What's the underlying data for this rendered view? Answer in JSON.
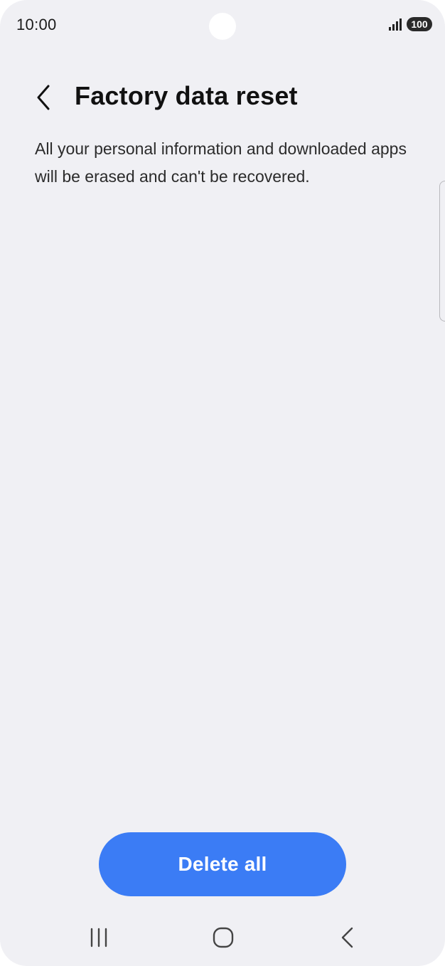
{
  "status_bar": {
    "time": "10:00",
    "battery_level": "100",
    "icons": [
      "signal-icon",
      "battery-icon"
    ]
  },
  "header": {
    "title": "Factory data reset",
    "back_icon": "chevron-left-icon"
  },
  "content": {
    "description": "All your personal information and downloaded apps will be erased and can't be recovered."
  },
  "actions": {
    "delete_all_label": "Delete all"
  },
  "navigation_bar": {
    "icons": [
      "recent-apps-icon",
      "home-icon",
      "back-icon"
    ]
  },
  "colors": {
    "background": "#f0f0f4",
    "primary_button": "#3b7cf5",
    "text": "#111111"
  }
}
